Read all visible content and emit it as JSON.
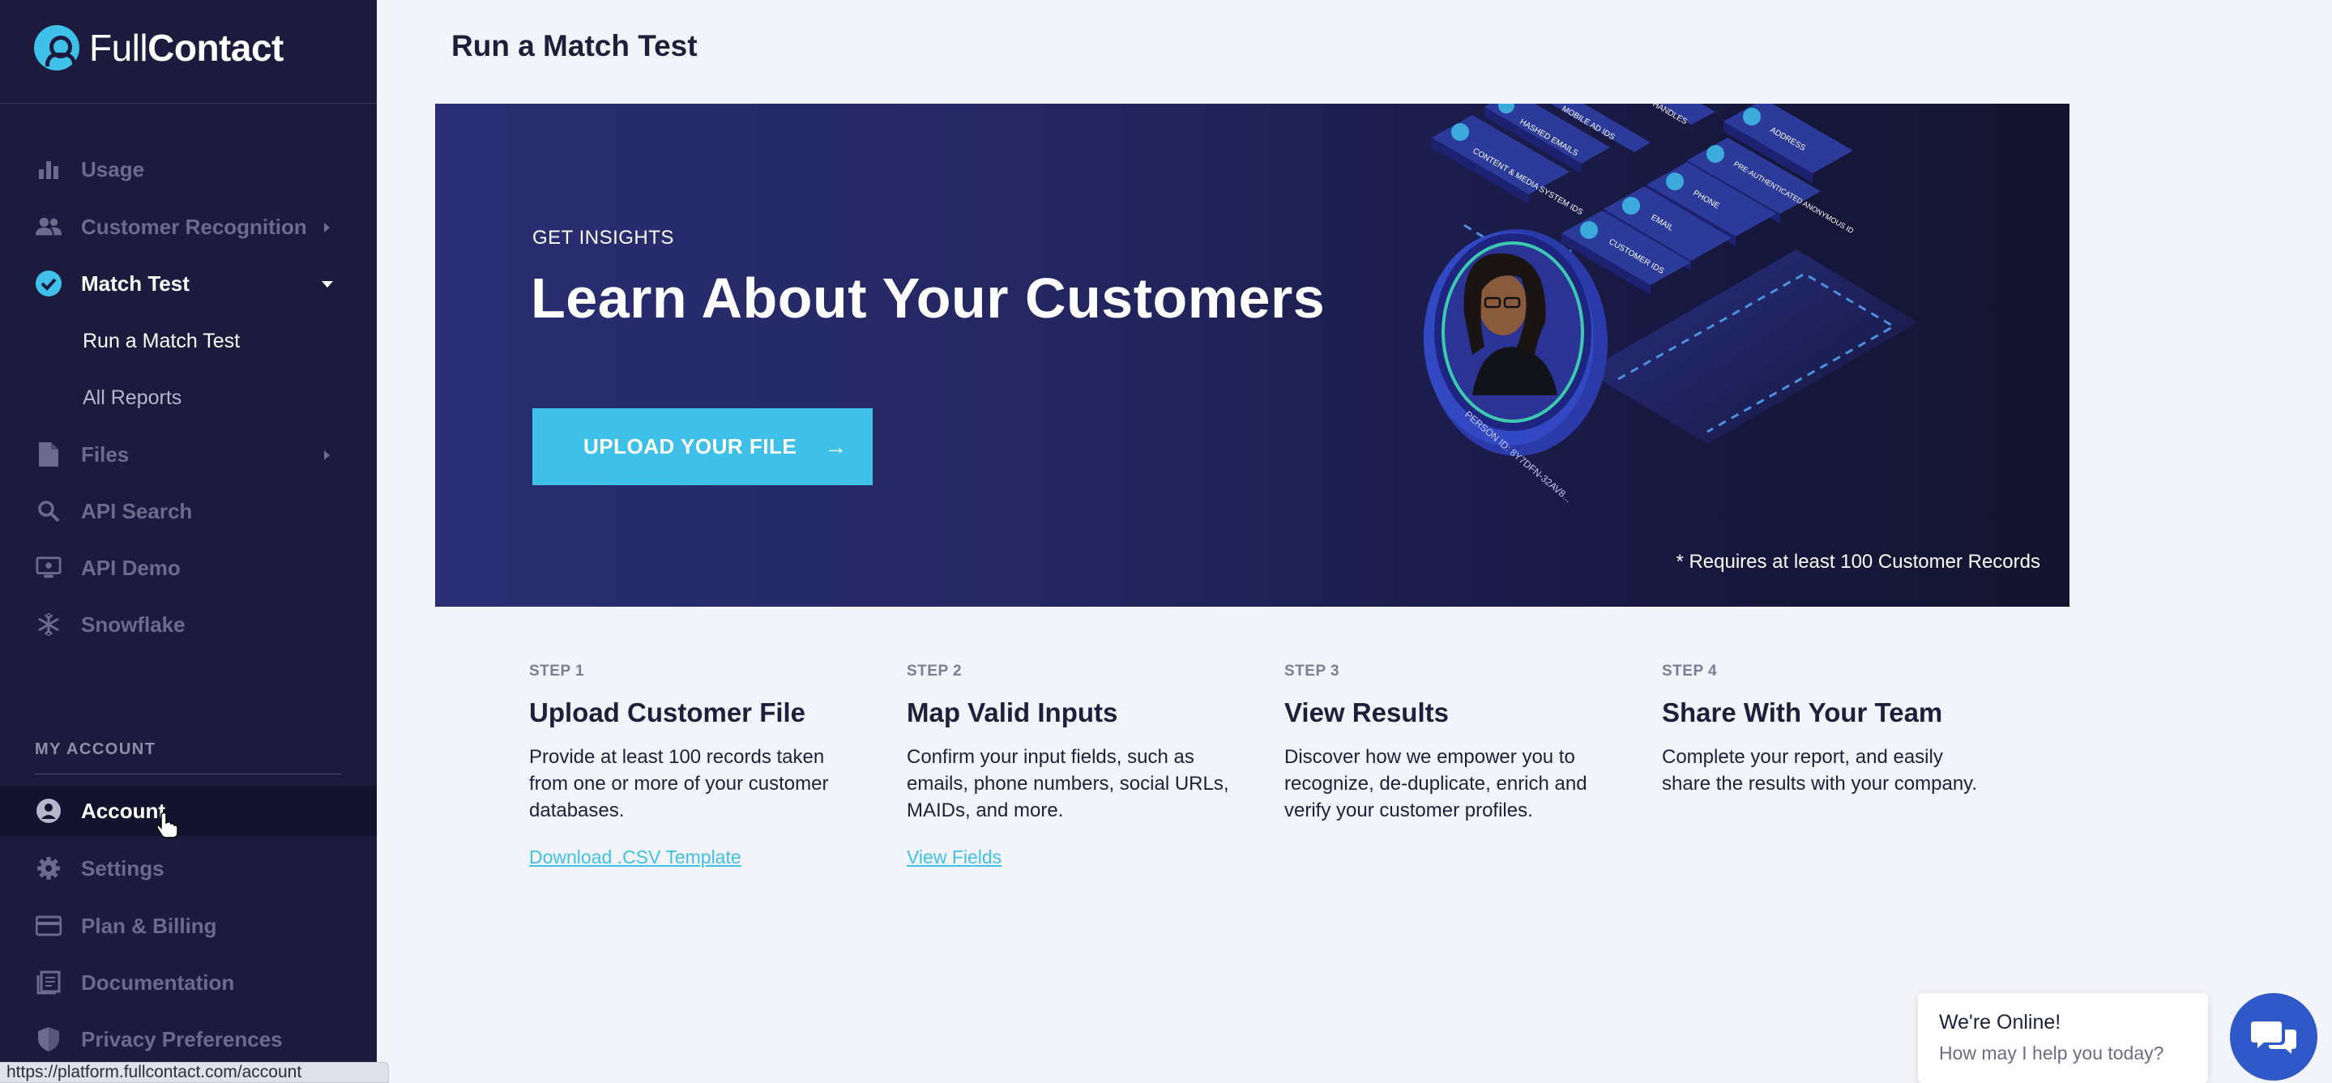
{
  "brand": {
    "name_light": "Full",
    "name_bold": "Contact"
  },
  "sidebar": {
    "items": [
      {
        "label": "Usage",
        "icon": "bar-chart-icon"
      },
      {
        "label": "Customer Recognition",
        "icon": "people-icon"
      },
      {
        "label": "Match Test",
        "icon": "check-circle-icon"
      },
      {
        "label": "Files",
        "icon": "file-icon"
      },
      {
        "label": "API Search",
        "icon": "search-icon"
      },
      {
        "label": "API Demo",
        "icon": "monitor-icon"
      },
      {
        "label": "Snowflake",
        "icon": "snowflake-icon"
      }
    ],
    "sub_items": [
      {
        "label": "Run a Match Test"
      },
      {
        "label": "All Reports"
      }
    ],
    "account_section_label": "MY ACCOUNT",
    "account_items": [
      {
        "label": "Account",
        "icon": "user-circle-icon"
      },
      {
        "label": "Settings",
        "icon": "gear-icon"
      },
      {
        "label": "Plan & Billing",
        "icon": "credit-card-icon"
      },
      {
        "label": "Documentation",
        "icon": "book-icon"
      },
      {
        "label": "Privacy Preferences",
        "icon": "shield-icon"
      }
    ]
  },
  "page": {
    "title": "Run a Match Test"
  },
  "hero": {
    "eyebrow": "GET INSIGHTS",
    "title": "Learn About Your Customers",
    "upload_button": "UPLOAD YOUR FILE",
    "upload_arrow": "→",
    "note": "* Requires at least 100 Customer Records",
    "tiles": [
      "CONTENT & MEDIA SYSTEM IDS",
      "HASHED EMAILS",
      "MOBILE AD IDS",
      "HANDLES",
      "ADDRESS",
      "PRE-AUTHENTICATED ANONYMOUS ID",
      "PHONE",
      "EMAIL",
      "CUSTOMER IDS"
    ],
    "person_id": "PERSON ID: 8Y7DFN-32AV8..."
  },
  "steps": [
    {
      "num": "STEP 1",
      "title": "Upload Customer File",
      "text": "Provide at least 100 records taken from one or more of your customer databases.",
      "link": "Download .CSV Template"
    },
    {
      "num": "STEP 2",
      "title": "Map Valid Inputs",
      "text": "Confirm your input fields, such as emails, phone numbers, social URLs, MAIDs, and more.",
      "link": "View Fields"
    },
    {
      "num": "STEP 3",
      "title": "View Results",
      "text": "Discover how we empower you to recognize, de-duplicate, enrich and verify your customer profiles.",
      "link": ""
    },
    {
      "num": "STEP 4",
      "title": "Share With Your Team",
      "text": "Complete your report, and easily share the results with your company.",
      "link": ""
    }
  ],
  "chat": {
    "title": "We're Online!",
    "subtitle": "How may I help you today?"
  },
  "status_url": "https://platform.fullcontact.com/account"
}
